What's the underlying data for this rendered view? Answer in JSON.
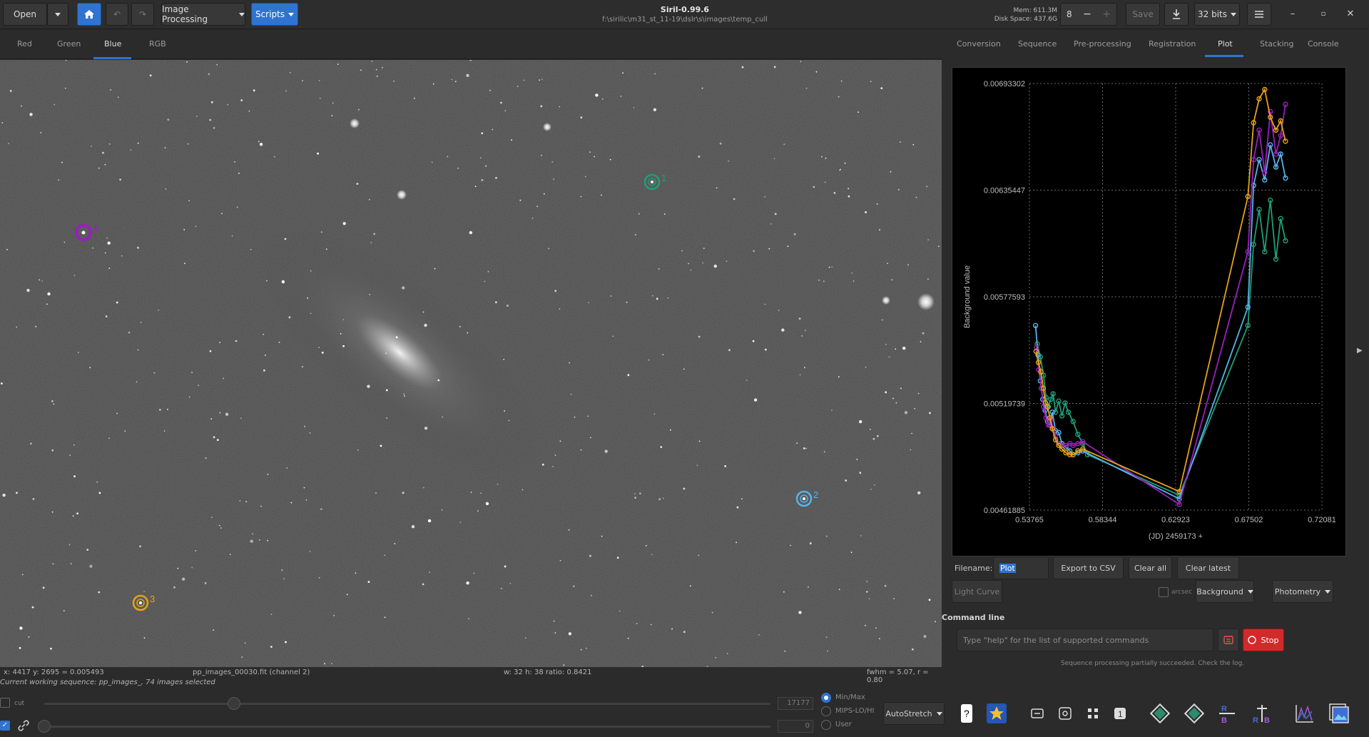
{
  "header": {
    "open_label": "Open",
    "image_processing_label": "Image Processing",
    "scripts_label": "Scripts",
    "app_title": "Siril-0.99.6",
    "app_path": "f:\\sirilic\\m31_st_11-19\\dslr\\s\\images\\temp_cull",
    "mem_label": "Mem: 611.3M",
    "disk_label": "Disk Space: 437.6G",
    "thread_value": "8",
    "save_label": "Save",
    "bits_label": "32 bits"
  },
  "channel_tabs": [
    "Red",
    "Green",
    "Blue",
    "RGB"
  ],
  "right_tabs": [
    "Conversion",
    "Sequence",
    "Pre-processing",
    "Registration",
    "Plot",
    "Stacking",
    "Console"
  ],
  "stars": [
    {
      "number": "1",
      "color": "#1f9e76"
    },
    {
      "number": "2",
      "color": "#56b4e9"
    },
    {
      "number": "3",
      "color": "#e6a117"
    },
    {
      "number": "4",
      "color": "#9b1fbf"
    }
  ],
  "plot": {
    "filename_label": "Filename:",
    "filename_value": "Plot",
    "export_label": "Export to CSV",
    "clear_all_label": "Clear all",
    "clear_latest_label": "Clear latest",
    "light_curve_label": "Light Curve",
    "arcsec_label": "arcsec",
    "background_label": "Background",
    "photometry_label": "Photometry"
  },
  "command_line": {
    "label": "Command line",
    "placeholder": "Type \"help\" for the list of supported commands",
    "stop_label": "Stop",
    "message": "Sequence processing partially succeeded. Check the log."
  },
  "status": {
    "coords": "x: 4417 y: 2695 = 0.005493",
    "file": "pp_images_00030.fit (channel 2)",
    "size": "w: 32 h: 38 ratio: 0.8421",
    "fwhm": "fwhm = 5.07, r = 0.80",
    "sequence": "Current working sequence: pp_images_, 74 images selected"
  },
  "bottom": {
    "cut_label": "cut",
    "hi_value": "17177",
    "lo_value": "0",
    "radio_options": [
      "Min/Max",
      "MIPS-LO/HI",
      "User"
    ],
    "stretch_label": "AutoStretch"
  },
  "chart_data": {
    "type": "line",
    "title": "",
    "xlabel": "(JD) 2459173 +",
    "ylabel": "Background value",
    "x_ticks": [
      "0.53765",
      "0.58344",
      "0.62923",
      "0.67502",
      "0.72081"
    ],
    "y_ticks": [
      "0.00693302",
      "0.00635447",
      "0.00577593",
      "0.00519739",
      "0.00461885"
    ],
    "xlim": [
      0.53765,
      0.72081
    ],
    "ylim": [
      0.00461885,
      0.00693302
    ],
    "grid": true,
    "series": [
      {
        "color": "#1f9e76",
        "x": [
          0.5425,
          0.5445,
          0.5465,
          0.548,
          0.5495,
          0.551,
          0.5525,
          0.554,
          0.556,
          0.558,
          0.56,
          0.562,
          0.565,
          0.568,
          0.571,
          0.574,
          0.6315,
          0.6745,
          0.678,
          0.6815,
          0.685,
          0.6885,
          0.692,
          0.695,
          0.698
        ],
        "y": [
          0.00552,
          0.00545,
          0.00535,
          0.00523,
          0.00518,
          0.00522,
          0.00525,
          0.00515,
          0.00521,
          0.00513,
          0.0052,
          0.00515,
          0.0051,
          0.00503,
          0.00498,
          0.00492,
          0.0047,
          0.00562,
          0.00606,
          0.00625,
          0.00602,
          0.0063,
          0.00598,
          0.0062,
          0.00608
        ]
      },
      {
        "color": "#56b4e9",
        "x": [
          0.5415,
          0.543,
          0.5445,
          0.546,
          0.5475,
          0.549,
          0.5505,
          0.552,
          0.554,
          0.556,
          0.558,
          0.5605,
          0.563,
          0.565,
          0.568,
          0.571,
          0.6315,
          0.6745,
          0.678,
          0.6815,
          0.685,
          0.6885,
          0.692,
          0.695,
          0.698
        ],
        "y": [
          0.00562,
          0.00546,
          0.00532,
          0.00522,
          0.00516,
          0.0051,
          0.00508,
          0.00515,
          0.00505,
          0.00504,
          0.00498,
          0.00496,
          0.00494,
          0.00492,
          0.00493,
          0.00494,
          0.00468,
          0.00572,
          0.00638,
          0.00652,
          0.00641,
          0.0066,
          0.00648,
          0.00655,
          0.00642
        ]
      },
      {
        "color": "#9b1fbf",
        "x": [
          0.542,
          0.5435,
          0.545,
          0.5465,
          0.548,
          0.5495,
          0.551,
          0.5525,
          0.554,
          0.556,
          0.558,
          0.5605,
          0.563,
          0.565,
          0.568,
          0.571,
          0.6315,
          0.6745,
          0.678,
          0.6815,
          0.685,
          0.6885,
          0.692,
          0.695,
          0.698
        ],
        "y": [
          0.0055,
          0.00538,
          0.00528,
          0.00518,
          0.00512,
          0.00508,
          0.00511,
          0.00506,
          0.00502,
          0.00498,
          0.00497,
          0.00497,
          0.00498,
          0.00497,
          0.00498,
          0.00499,
          0.00465,
          0.00602,
          0.00652,
          0.00668,
          0.00645,
          0.00678,
          0.00655,
          0.00665,
          0.00682
        ]
      },
      {
        "color": "#e6a117",
        "x": [
          0.5418,
          0.5433,
          0.5448,
          0.5463,
          0.5478,
          0.549,
          0.5505,
          0.552,
          0.554,
          0.556,
          0.558,
          0.5605,
          0.563,
          0.565,
          0.568,
          0.571,
          0.6315,
          0.6745,
          0.678,
          0.6815,
          0.685,
          0.6885,
          0.692,
          0.695,
          0.698
        ],
        "y": [
          0.00548,
          0.00542,
          0.00537,
          0.00528,
          0.0052,
          0.00518,
          0.00512,
          0.00506,
          0.005,
          0.00497,
          0.00495,
          0.00493,
          0.00492,
          0.00492,
          0.00494,
          0.00495,
          0.00472,
          0.00632,
          0.00672,
          0.00685,
          0.0069,
          0.00675,
          0.00668,
          0.00673,
          0.00662
        ]
      }
    ]
  }
}
